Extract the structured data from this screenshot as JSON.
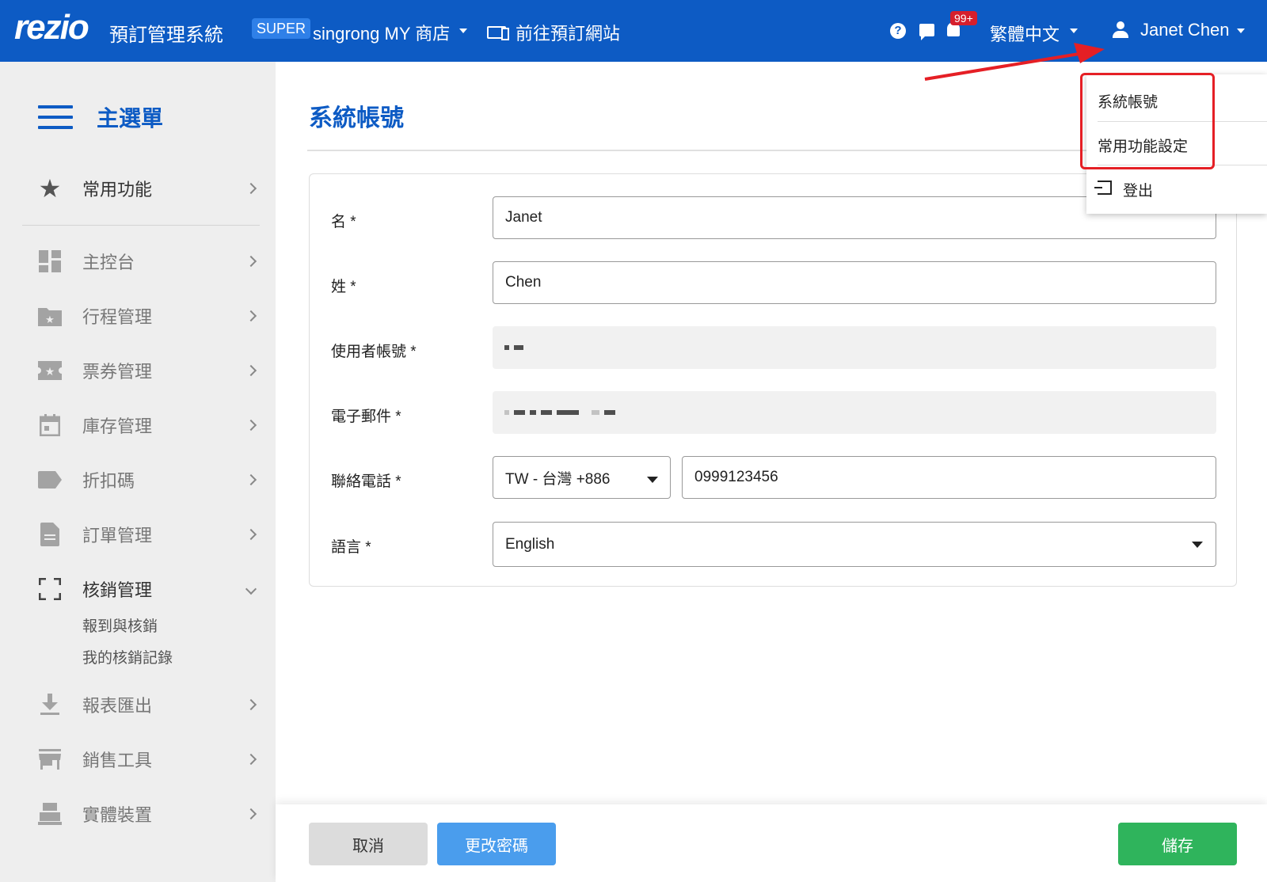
{
  "header": {
    "logo": "rezio",
    "system_name": "預訂管理系統",
    "plan_badge": "SUPER",
    "store_name": "singrong MY 商店",
    "booking_site_link": "前往預訂網站",
    "notification_count": "99+",
    "language": "繁體中文",
    "username": "Janet Chen",
    "brand_color": "#0d5bc4"
  },
  "sidebar": {
    "title": "主選單",
    "favorites": {
      "label": "常用功能",
      "icon": "star-icon"
    },
    "items": [
      {
        "label": "主控台",
        "icon": "dashboard-icon"
      },
      {
        "label": "行程管理",
        "icon": "folder-star-icon"
      },
      {
        "label": "票券管理",
        "icon": "ticket-icon"
      },
      {
        "label": "庫存管理",
        "icon": "calendar-icon"
      },
      {
        "label": "折扣碼",
        "icon": "tag-icon"
      },
      {
        "label": "訂單管理",
        "icon": "document-icon"
      },
      {
        "label": "核銷管理",
        "icon": "scan-icon",
        "expanded": true
      },
      {
        "label": "報表匯出",
        "icon": "download-icon"
      },
      {
        "label": "銷售工具",
        "icon": "store-icon"
      },
      {
        "label": "實體裝置",
        "icon": "pos-icon"
      }
    ],
    "sub_items": [
      "報到與核銷",
      "我的核銷記錄"
    ]
  },
  "page": {
    "title": "系統帳號"
  },
  "form": {
    "first_name_label": "名 *",
    "first_name_value": "Janet",
    "last_name_label": "姓 *",
    "last_name_value": "Chen",
    "username_label": "使用者帳號 *",
    "email_label": "電子郵件 *",
    "phone_label": "聯絡電話 *",
    "phone_country": "TW - 台灣 +886",
    "phone_number": "0999123456",
    "language_label": "語言 *",
    "language_value": "English"
  },
  "user_menu": {
    "items": [
      "系統帳號",
      "常用功能設定"
    ],
    "logout": "登出"
  },
  "actions": {
    "cancel": "取消",
    "change_password": "更改密碼",
    "save": "儲存",
    "save_color": "#2fb45c",
    "change_password_color": "#4a9ded"
  }
}
